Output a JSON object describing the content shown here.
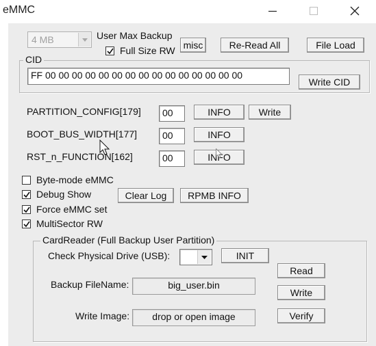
{
  "window": {
    "title": "eMMC",
    "minimize_icon": "minimize-icon",
    "maximize_icon": "maximize-icon",
    "close_icon": "close-icon"
  },
  "backup": {
    "size_selected": "4 MB",
    "user_max_backup_label": "User Max Backup",
    "full_size_rw_label": "Full Size RW",
    "full_size_rw_checked": true,
    "misc_button": "misc",
    "reread_all_button": "Re-Read All",
    "file_load_button": "File Load"
  },
  "cid": {
    "group_title": "CID",
    "value": "FF 00 00 00 00 00 00 00 00 00 00 00 00 00 00 00",
    "write_cid_button": "Write CID"
  },
  "registers": [
    {
      "label": "PARTITION_CONFIG[179]",
      "value": "00",
      "info_button": "INFO",
      "write_button": "Write"
    },
    {
      "label": "BOOT_BUS_WIDTH[177]",
      "value": "00",
      "info_button": "INFO"
    },
    {
      "label": "RST_n_FUNCTION[162]",
      "value": "00",
      "info_button": "INFO"
    }
  ],
  "options": {
    "byte_mode": {
      "label": "Byte-mode eMMC",
      "checked": false
    },
    "debug_show": {
      "label": "Debug Show",
      "checked": true
    },
    "force_emmc": {
      "label": "Force eMMC set",
      "checked": true
    },
    "multisector": {
      "label": "MultiSector RW",
      "checked": true
    },
    "clear_log_button": "Clear Log",
    "rpmb_info_button": "RPMB INFO"
  },
  "cardreader": {
    "group_title": "CardReader (Full Backup User Partition)",
    "check_drive_label": "Check Physical Drive (USB):",
    "drive_selected": "",
    "init_button": "INIT",
    "read_button": "Read",
    "backup_filename_label": "Backup FileName:",
    "backup_filename_value": "big_user.bin",
    "write_button": "Write",
    "write_image_label": "Write Image:",
    "write_image_value": "drop or open image",
    "verify_button": "Verify"
  }
}
